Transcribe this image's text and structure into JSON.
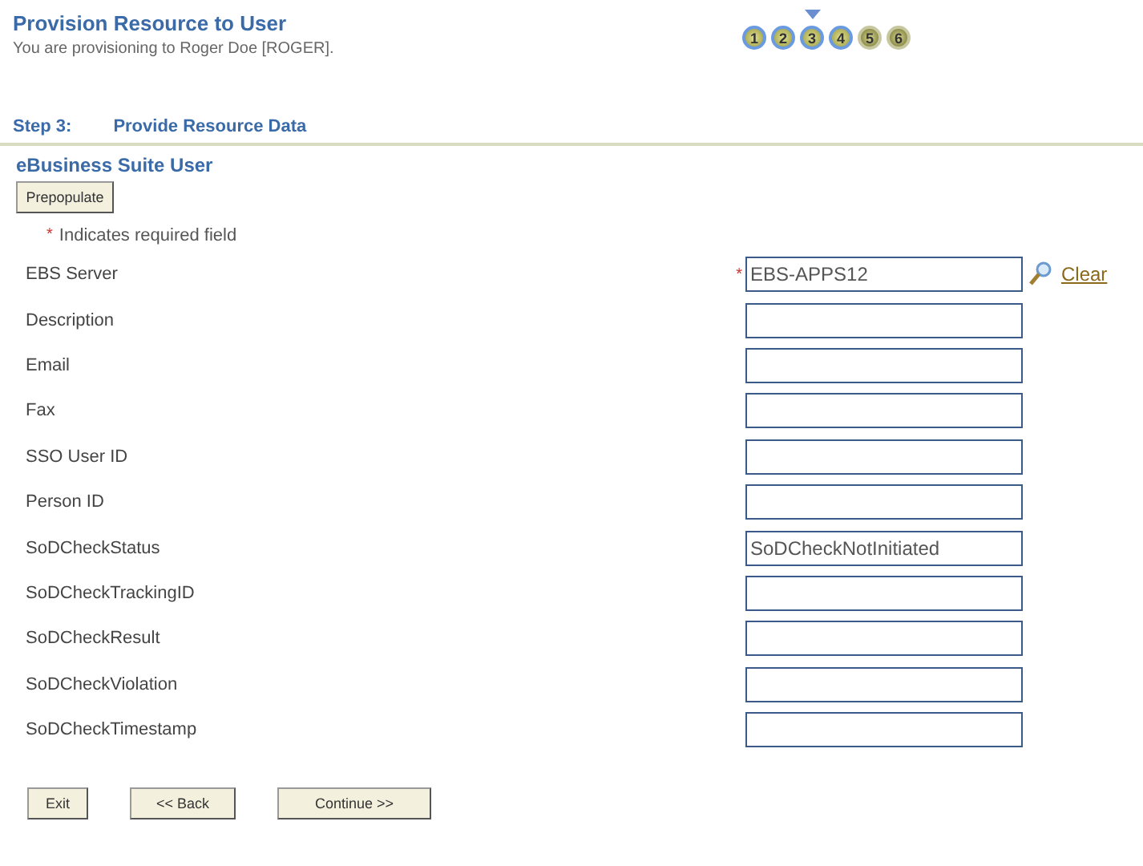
{
  "header": {
    "title": "Provision Resource to User",
    "subtitle": "You are provisioning to Roger Doe [ROGER]."
  },
  "steps": [
    {
      "label": "1",
      "selected": false,
      "available": true
    },
    {
      "label": "2",
      "selected": false,
      "available": true
    },
    {
      "label": "3",
      "selected": true,
      "available": true
    },
    {
      "label": "4",
      "selected": false,
      "available": true
    },
    {
      "label": "5",
      "selected": false,
      "available": false
    },
    {
      "label": "6",
      "selected": false,
      "available": false
    }
  ],
  "step_heading": {
    "number": "Step 3:",
    "title": "Provide Resource Data"
  },
  "section_title": "eBusiness Suite User",
  "prepopulate_button": "Prepopulate",
  "required_note": {
    "mark": "*",
    "text": "Indicates required field"
  },
  "fields": [
    {
      "label": "EBS Server",
      "kind": "lookup",
      "required_mark": "*",
      "value": "EBS-APPS12",
      "link": "Clear"
    },
    {
      "label": "Description",
      "kind": "text"
    },
    {
      "label": "Email",
      "kind": "text"
    },
    {
      "label": "Fax",
      "kind": "text"
    },
    {
      "label": "SSO User ID",
      "kind": "text"
    },
    {
      "label": "Person ID",
      "kind": "text"
    },
    {
      "label": "SoDCheckStatus",
      "kind": "text",
      "value": "SoDCheckNotInitiated"
    },
    {
      "label": "SoDCheckTrackingID",
      "kind": "text"
    },
    {
      "label": "SoDCheckResult",
      "kind": "text"
    },
    {
      "label": "SoDCheckViolation",
      "kind": "text"
    },
    {
      "label": "SoDCheckTimestamp",
      "kind": "text"
    }
  ],
  "buttons": [
    "Exit",
    "<< Back",
    "Continue >>"
  ]
}
